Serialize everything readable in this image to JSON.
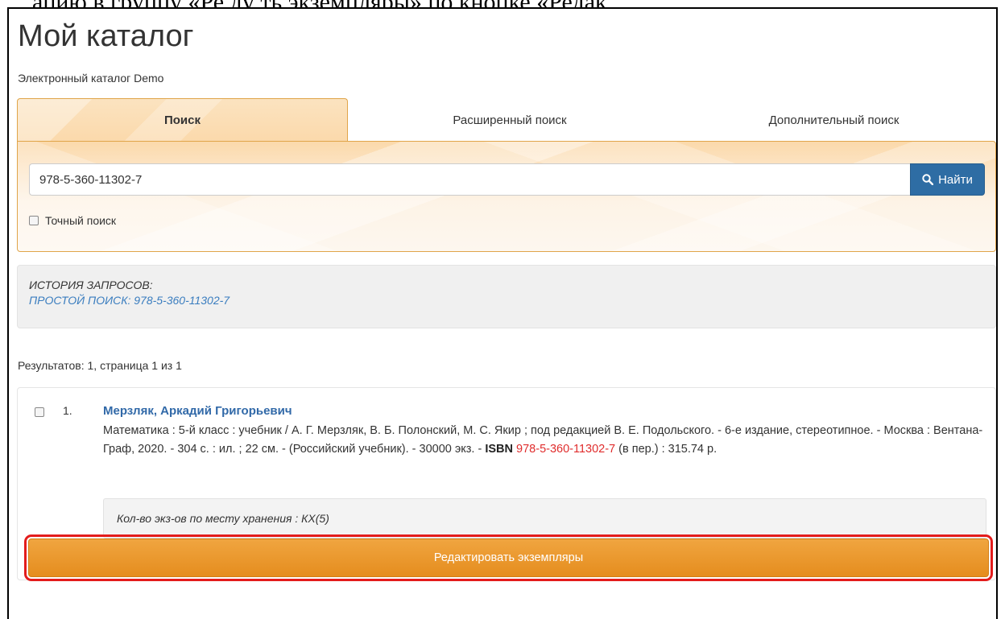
{
  "top_fragment": "ацию в группу «Ре ду ть экземпляры» по кнопке «Редак",
  "page": {
    "title": "Мой каталог",
    "subtitle": "Электронный каталог Demo"
  },
  "tabs": [
    {
      "label": "Поиск",
      "active": true
    },
    {
      "label": "Расширенный поиск",
      "active": false
    },
    {
      "label": "Дополнительный поиск",
      "active": false
    }
  ],
  "search": {
    "value": "978-5-360-11302-7",
    "button_label": "Найти",
    "button_icon": "search-icon",
    "exact_label": "Точный поиск",
    "exact_checked": false
  },
  "history": {
    "title": "История запросов:",
    "link": "Простой поиск: 978-5-360-11302-7"
  },
  "results": {
    "summary": "Результатов: 1, страница 1 из 1",
    "items": [
      {
        "number": "1.",
        "author": "Мерзляк, Аркадий Григорьевич",
        "description": "Математика : 5-й класс : учебник / А. Г. Мерзляк, В. Б. Полонский, М. С. Якир ; под редакцией В. Е. Подольского. - 6-е издание, стереотипное. - Москва : Вентана-Граф, 2020. - 304 с. : ил. ; 22 см. - (Российский учебник). - 30000 экз. -",
        "isbn_label": "ISBN",
        "isbn_value": "978-5-360-11302-7",
        "price": "(в пер.) : 315.74 р.",
        "holdings": "Кол-во экз-ов по месту хранения : КХ(5)"
      }
    ]
  },
  "actions": {
    "edit_copies": "Редактировать экземпляры"
  },
  "colors": {
    "primary_button": "#2e6da4",
    "link": "#3a7dbf",
    "author": "#3169a8",
    "isbn": "#e02d2d",
    "edit_button": "#e99426",
    "highlight": "#e31c1c"
  }
}
